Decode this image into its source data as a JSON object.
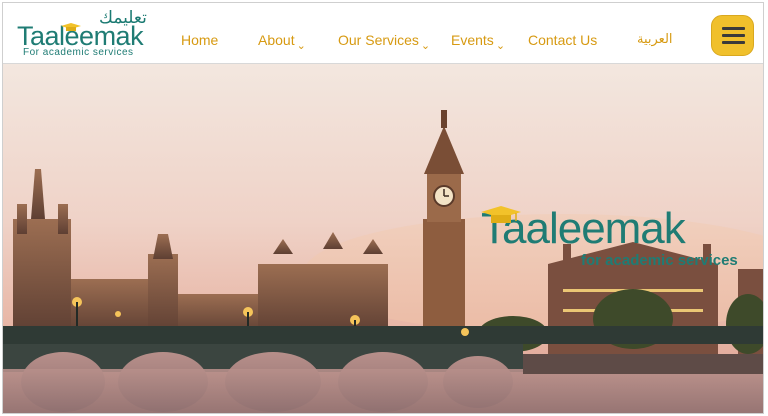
{
  "logo": {
    "arabic": "تعليمك",
    "name": "Taaleemak",
    "tagline": "For academic services"
  },
  "nav": {
    "items": [
      {
        "label": "Home",
        "has_caret": false
      },
      {
        "label": "About",
        "has_caret": true
      },
      {
        "label": "Our Services",
        "has_caret": true
      },
      {
        "label": "Events",
        "has_caret": true
      },
      {
        "label": "Contact Us",
        "has_caret": false
      },
      {
        "label": "العربية",
        "has_caret": false
      }
    ],
    "menu_icon": "hamburger-icon"
  },
  "hero": {
    "brand_name": "Taaleemak",
    "brand_tagline": "for academic services"
  },
  "colors": {
    "brand_teal": "#1f7c74",
    "nav_gold": "#d79a12",
    "menu_yellow": "#f0c02c",
    "cap_yellow": "#f2c22a"
  }
}
